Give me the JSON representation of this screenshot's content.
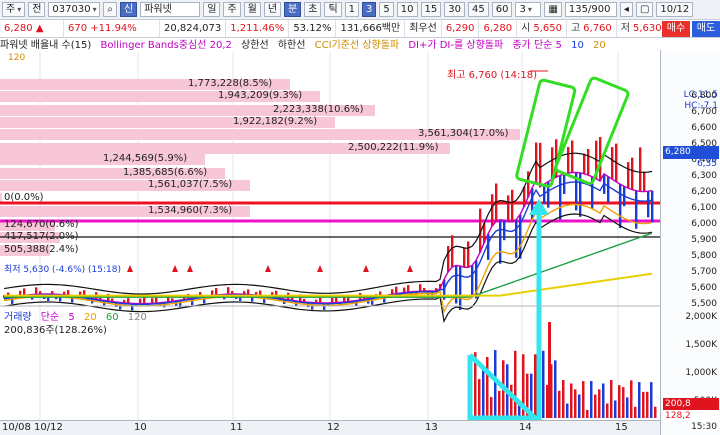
{
  "toolbar": {
    "market_type": "주",
    "prefix": "전",
    "code": "037030",
    "badge": "신",
    "name": "파워넷",
    "periods": [
      "일",
      "주",
      "월",
      "년",
      "분",
      "초",
      "틱"
    ],
    "selected_period": "분",
    "intervals": [
      "1",
      "3",
      "5",
      "10",
      "15",
      "30",
      "45",
      "60"
    ],
    "selected_interval": "3",
    "count_value": "3",
    "count_display": "135/900",
    "date": "10/12"
  },
  "quote": {
    "price": "6,280",
    "arrow": "▲",
    "change": "670",
    "change_pct": "+11.94%",
    "volume": "20,824,073",
    "volume_pct": "1,211.46%",
    "power": "53.12%",
    "amount": "131,666백만",
    "best_ask_label": "최우선",
    "best_ask": "6,290",
    "best_bid": "6,280",
    "open_label": "시",
    "open": "5,650",
    "high_label": "고",
    "high": "6,760",
    "low_label": "저",
    "low": "5,630"
  },
  "buttons": {
    "buy": "매수",
    "sell": "매도"
  },
  "legend": {
    "items": [
      {
        "text": "파워넷 배율내 수(15)",
        "color": "#333333"
      },
      {
        "text": "Bollinger Bands중심선 20,2",
        "color": "#c000c0"
      },
      {
        "text": "상한선",
        "color": "#333333"
      },
      {
        "text": "하한선",
        "color": "#333333"
      },
      {
        "text": "CCI기준선 상향돌파",
        "color": "#d08a00"
      },
      {
        "text": "DI+가 DI-를 상향돌파",
        "color": "#c000c0"
      },
      {
        "text": "종가 단순 5",
        "color": "#c000c0"
      },
      {
        "text": "10",
        "color": "#1a3cd6"
      },
      {
        "text": "20",
        "color": "#d08a00"
      }
    ],
    "sub": "120",
    "right_top": [
      "LC:11.5",
      "HC:-7.1"
    ]
  },
  "annotations": {
    "high_marker": "최고 6,760 (14:18)",
    "low_marker": "최저 5,630 (-4.6%) (15:18)",
    "volume_profile": [
      {
        "text": "1,773,228(8.5%)"
      },
      {
        "text": "1,943,209(9.3%)"
      },
      {
        "text": "2,223,338(10.6%)"
      },
      {
        "text": "1,922,182(9.2%)"
      },
      {
        "text": "3,561,304(17.0%)"
      },
      {
        "text": "2,500,222(11.9%)"
      },
      {
        "text": "1,244,569(5.9%)"
      },
      {
        "text": "1,385,685(6.6%)"
      },
      {
        "text": "1,561,037(7.5%)"
      },
      {
        "text": "0(0.0%)"
      },
      {
        "text": "1,534,960(7.3%)"
      },
      {
        "text": "124,670(0.6%)"
      },
      {
        "text": "417,517(2.0%)"
      },
      {
        "text": "505,388(2.4%)"
      }
    ]
  },
  "price_axis": {
    "ticks": [
      "6,800",
      "6,700",
      "6,600",
      "6,500",
      "6,400",
      "6,300",
      "6,200",
      "6,100",
      "6,000",
      "5,900",
      "5,800",
      "5,700",
      "5,600",
      "5,500"
    ],
    "current_price": "6,280",
    "current_sub": "6,35"
  },
  "volume_axis": {
    "ticks": [
      "2,000K",
      "1,500K",
      "1,000K",
      "500K"
    ],
    "current": "200,8",
    "current2": "128,2"
  },
  "volume_panel": {
    "title": "거래량",
    "ma_label": "단순",
    "ma_periods": [
      "5",
      "20",
      "60",
      "120"
    ],
    "current": "200,836주(128.26%)"
  },
  "date_axis": {
    "labels": [
      "10/08",
      "10/12",
      "10",
      "11",
      "12",
      "13",
      "14",
      "15"
    ],
    "time_right": "15:30"
  },
  "colors": {
    "up": "#e0141e",
    "down": "#1a3cd6",
    "bb_mid": "#c000c0",
    "ma5": "#c000c0",
    "ma10": "#1a3cd6",
    "ma20": "#f0a000",
    "ma60": "#20a040",
    "ma120": "#e8d000",
    "profile_bar": "#f7c6d7",
    "annot_green": "#33dd22",
    "annot_cyan": "#33e6ee",
    "hline_red": "#ee1122",
    "hline_magenta": "#ee11cc"
  }
}
